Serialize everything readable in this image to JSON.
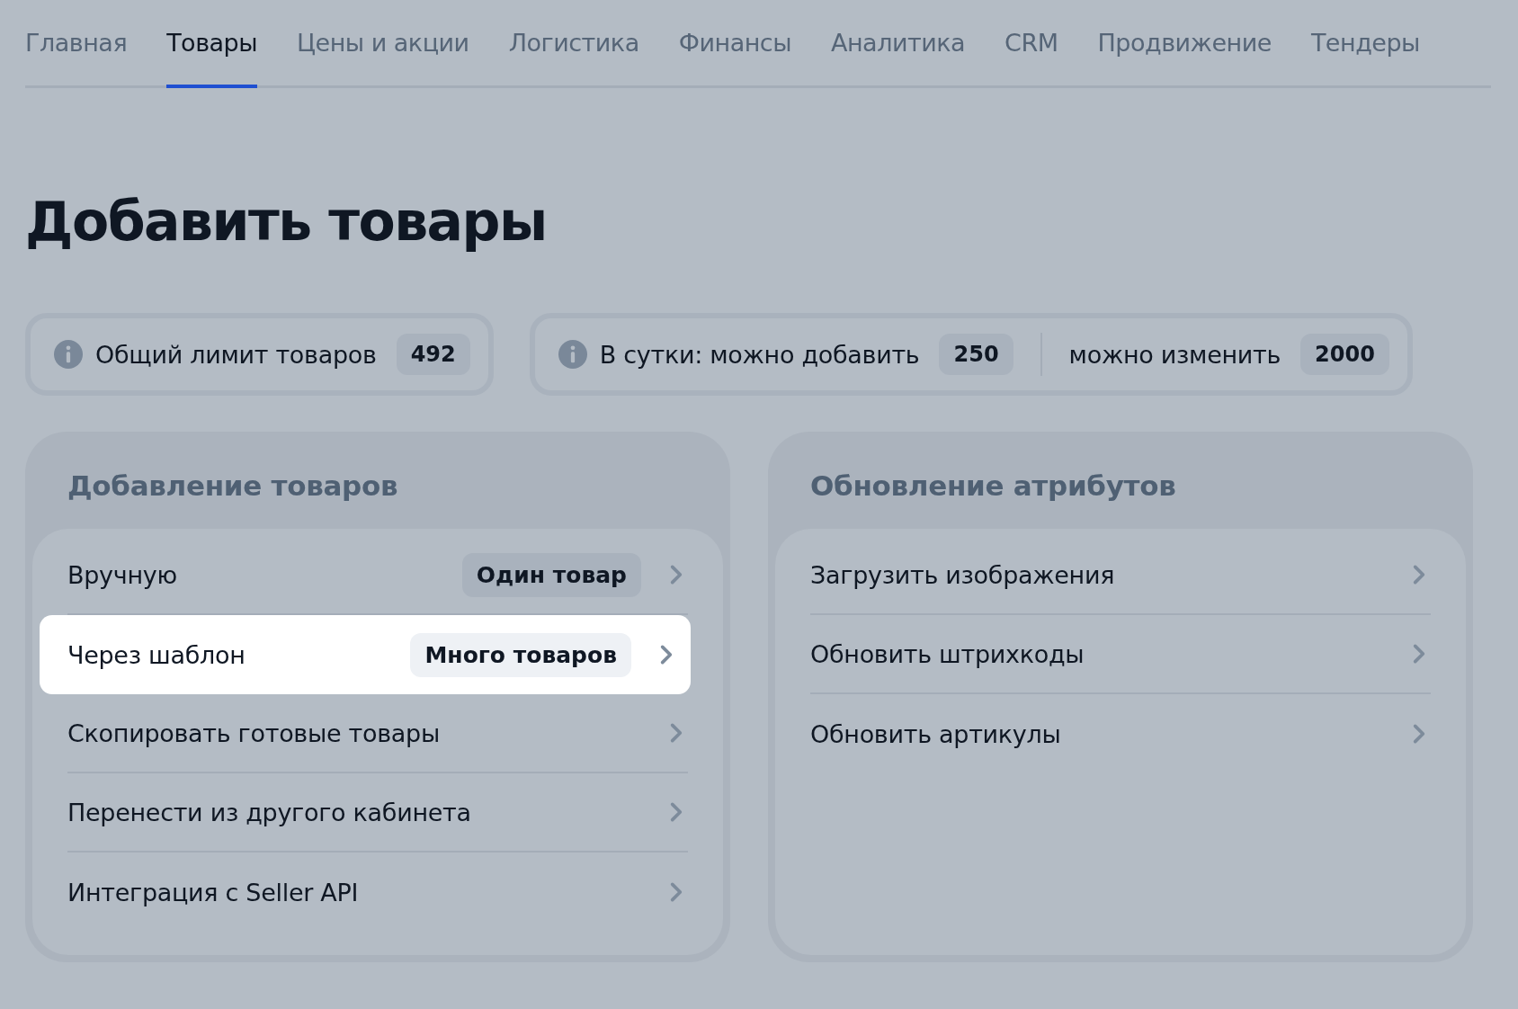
{
  "tabs": [
    {
      "label": "Главная",
      "selected": false
    },
    {
      "label": "Товары",
      "selected": true
    },
    {
      "label": "Цены и акции",
      "selected": false
    },
    {
      "label": "Логистика",
      "selected": false
    },
    {
      "label": "Финансы",
      "selected": false
    },
    {
      "label": "Аналитика",
      "selected": false
    },
    {
      "label": "CRM",
      "selected": false
    },
    {
      "label": "Продвижение",
      "selected": false
    },
    {
      "label": "Тендеры",
      "selected": false
    }
  ],
  "title": "Добавить товары",
  "limits": [
    {
      "parts": [
        {
          "label": "Общий лимит товаров",
          "value": "492"
        }
      ]
    },
    {
      "parts": [
        {
          "label": "В сутки: можно добавить",
          "value": "250"
        },
        {
          "label": "можно изменить",
          "value": "2000"
        }
      ]
    }
  ],
  "cards": [
    {
      "title": "Добавление товаров",
      "items": [
        {
          "label": "Вручную",
          "tag": "Один товар",
          "selected": false
        },
        {
          "label": "Через шаблон",
          "tag": "Много товаров",
          "selected": true
        },
        {
          "label": "Скопировать готовые товары",
          "selected": false
        },
        {
          "label": "Перенести из другого кабинета",
          "selected": false
        },
        {
          "label": "Интеграция с Seller API",
          "selected": false
        }
      ]
    },
    {
      "title": "Обновление атрибутов",
      "items": [
        {
          "label": "Загрузить изображения",
          "selected": false
        },
        {
          "label": "Обновить штрихкоды",
          "selected": false
        },
        {
          "label": "Обновить артикулы",
          "selected": false
        }
      ]
    }
  ]
}
